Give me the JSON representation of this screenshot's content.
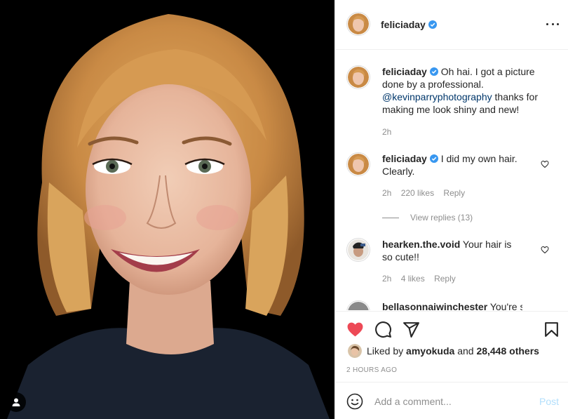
{
  "post": {
    "author": "feliciaday",
    "caption_text": "Oh hai. I got a picture done by a professional.",
    "caption_mention": "@kevinparryphotography",
    "caption_tail": "thanks for making me look shiny and new!",
    "caption_time": "2h"
  },
  "comments": [
    {
      "username": "feliciaday",
      "text": "I did my own hair. Clearly.",
      "time": "2h",
      "likes": "220 likes",
      "reply_label": "Reply",
      "view_replies": "View replies (13)"
    },
    {
      "username": "hearken.the.void",
      "text": "Your hair is so cute!!",
      "time": "2h",
      "likes": "4 likes",
      "reply_label": "Reply"
    },
    {
      "username": "bellasonnaiwinchester",
      "text": "You're so"
    }
  ],
  "likes_summary": {
    "prefix": "Liked by",
    "user": "amyokuda",
    "joiner": "and",
    "others": "28,448 others"
  },
  "timestamp": "2 HOURS AGO",
  "comment_box": {
    "placeholder": "Add a comment...",
    "post_label": "Post"
  },
  "icons": {
    "verified": "verified-badge-icon",
    "more": "more-options-icon",
    "like": "heart-icon",
    "comment": "comment-icon",
    "share": "share-icon",
    "save": "bookmark-icon",
    "emoji": "emoji-icon",
    "tag": "user-tag-icon"
  },
  "colors": {
    "liked_heart": "#ed4956",
    "verified_blue": "#3897f0",
    "mention_blue": "#00376b",
    "muted_text": "#8e8e8e",
    "post_disabled": "#b2dffc"
  }
}
